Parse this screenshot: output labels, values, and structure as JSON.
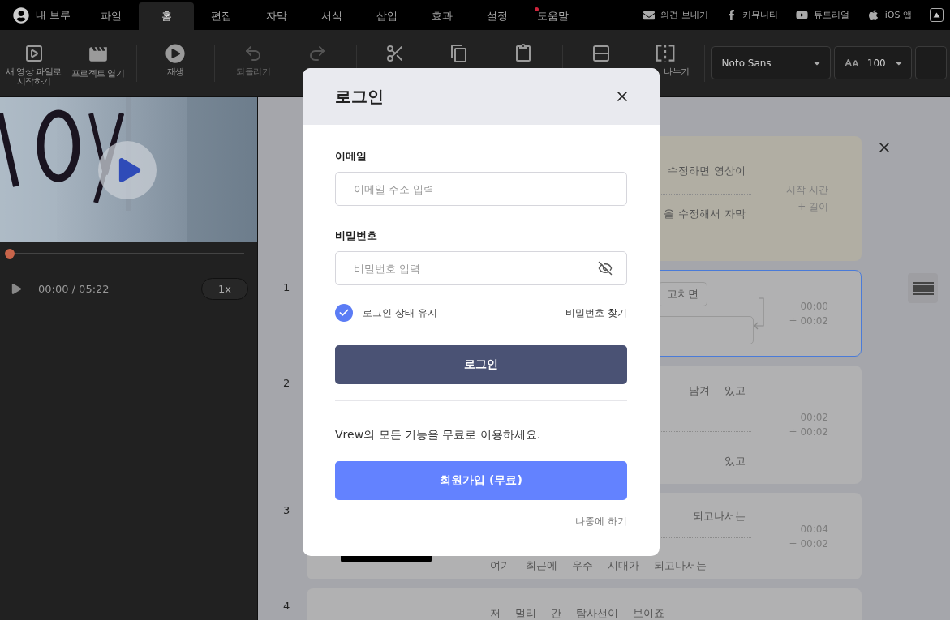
{
  "top_bar": {
    "account": "내 브루",
    "tabs": [
      {
        "label": "파일",
        "selected": false,
        "badge": false
      },
      {
        "label": "홈",
        "selected": true,
        "badge": false
      },
      {
        "label": "편집",
        "selected": false,
        "badge": false
      },
      {
        "label": "자막",
        "selected": false,
        "badge": false
      },
      {
        "label": "서식",
        "selected": false,
        "badge": false
      },
      {
        "label": "삽입",
        "selected": false,
        "badge": false
      },
      {
        "label": "효과",
        "selected": false,
        "badge": false
      },
      {
        "label": "설정",
        "selected": false,
        "badge": false
      },
      {
        "label": "도움말",
        "selected": false,
        "badge": true
      }
    ],
    "links": [
      {
        "label": "의견 보내기"
      },
      {
        "label": "커뮤니티"
      },
      {
        "label": "튜토리얼"
      },
      {
        "label": "iOS 앱"
      }
    ]
  },
  "toolbar": {
    "groups": [
      [
        {
          "label": "새 영상 파일로\n시작하기",
          "disabled": false
        },
        {
          "label": "프로젝트 열기",
          "disabled": false
        }
      ],
      [
        {
          "label": "재생",
          "disabled": false
        }
      ],
      [
        {
          "label": "되돌리기",
          "disabled": true
        },
        {
          "disabled": true
        }
      ],
      [
        {
          "disabled": false
        },
        {
          "disabled": false
        },
        {
          "disabled": false
        }
      ],
      [
        {
          "disabled": false
        },
        {
          "label": "나누기",
          "disabled": false,
          "clipped": true
        }
      ]
    ],
    "font": "Noto Sans",
    "size": "100"
  },
  "player": {
    "time": "00:00 / 05:22",
    "speed": "1x",
    "progress": {
      "level": 0
    }
  },
  "editor": {
    "rows": [
      {
        "kind": "tip",
        "selected": false,
        "lines": [
          {
            "kind": "clipped",
            "words": [
              "수정하면",
              "영상이"
            ]
          },
          {
            "kind": "clipped",
            "words": [
              "을",
              "수정해서",
              "자막"
            ]
          }
        ],
        "time": [
          "시작 시간",
          "+ 길이"
        ]
      },
      {
        "kind": "edit",
        "number": "1",
        "selected": true,
        "chip": "고치면",
        "time": [
          "00:00",
          "+ 00:02"
        ]
      },
      {
        "kind": "clip",
        "number": "2",
        "selected": false,
        "lines": [
          {
            "kind": "clipped",
            "words": [
              "담겨",
              "있고"
            ]
          },
          {
            "kind": "clipped",
            "words": [
              "있고"
            ]
          }
        ],
        "time": [
          "00:02",
          "+ 00:02"
        ]
      },
      {
        "kind": "clip",
        "number": "3",
        "selected": false,
        "thumbnail": true,
        "lines": [
          {
            "kind": "clipped",
            "words": [
              "되고나서는"
            ]
          },
          {
            "kind": "full",
            "words": [
              "여기",
              "최근에",
              "우주",
              "시대가",
              "되고나서는"
            ]
          }
        ],
        "time": [
          "00:04",
          "+ 00:02"
        ]
      },
      {
        "kind": "clip",
        "number": "4",
        "selected": false,
        "lines": [
          {
            "kind": "full",
            "words": [
              "저",
              "멀리",
              "간",
              "탐사선이",
              "보이죠"
            ]
          }
        ]
      }
    ]
  },
  "login_dialog": {
    "title": "로그인",
    "email": {
      "label": "이메일",
      "placeholder": "이메일 주소 입력"
    },
    "password": {
      "label": "비밀번호",
      "placeholder": "비밀번호 입력"
    },
    "remember": {
      "label": "로그인 상태 유지",
      "checked": true
    },
    "forgot": "비밀번호 찾기",
    "login_button": "로그인",
    "promo": "Vrew의 모든 기능을 무료로 이용하세요.",
    "signup_button": "회원가입 (무료)",
    "later": "나중에 하기"
  }
}
